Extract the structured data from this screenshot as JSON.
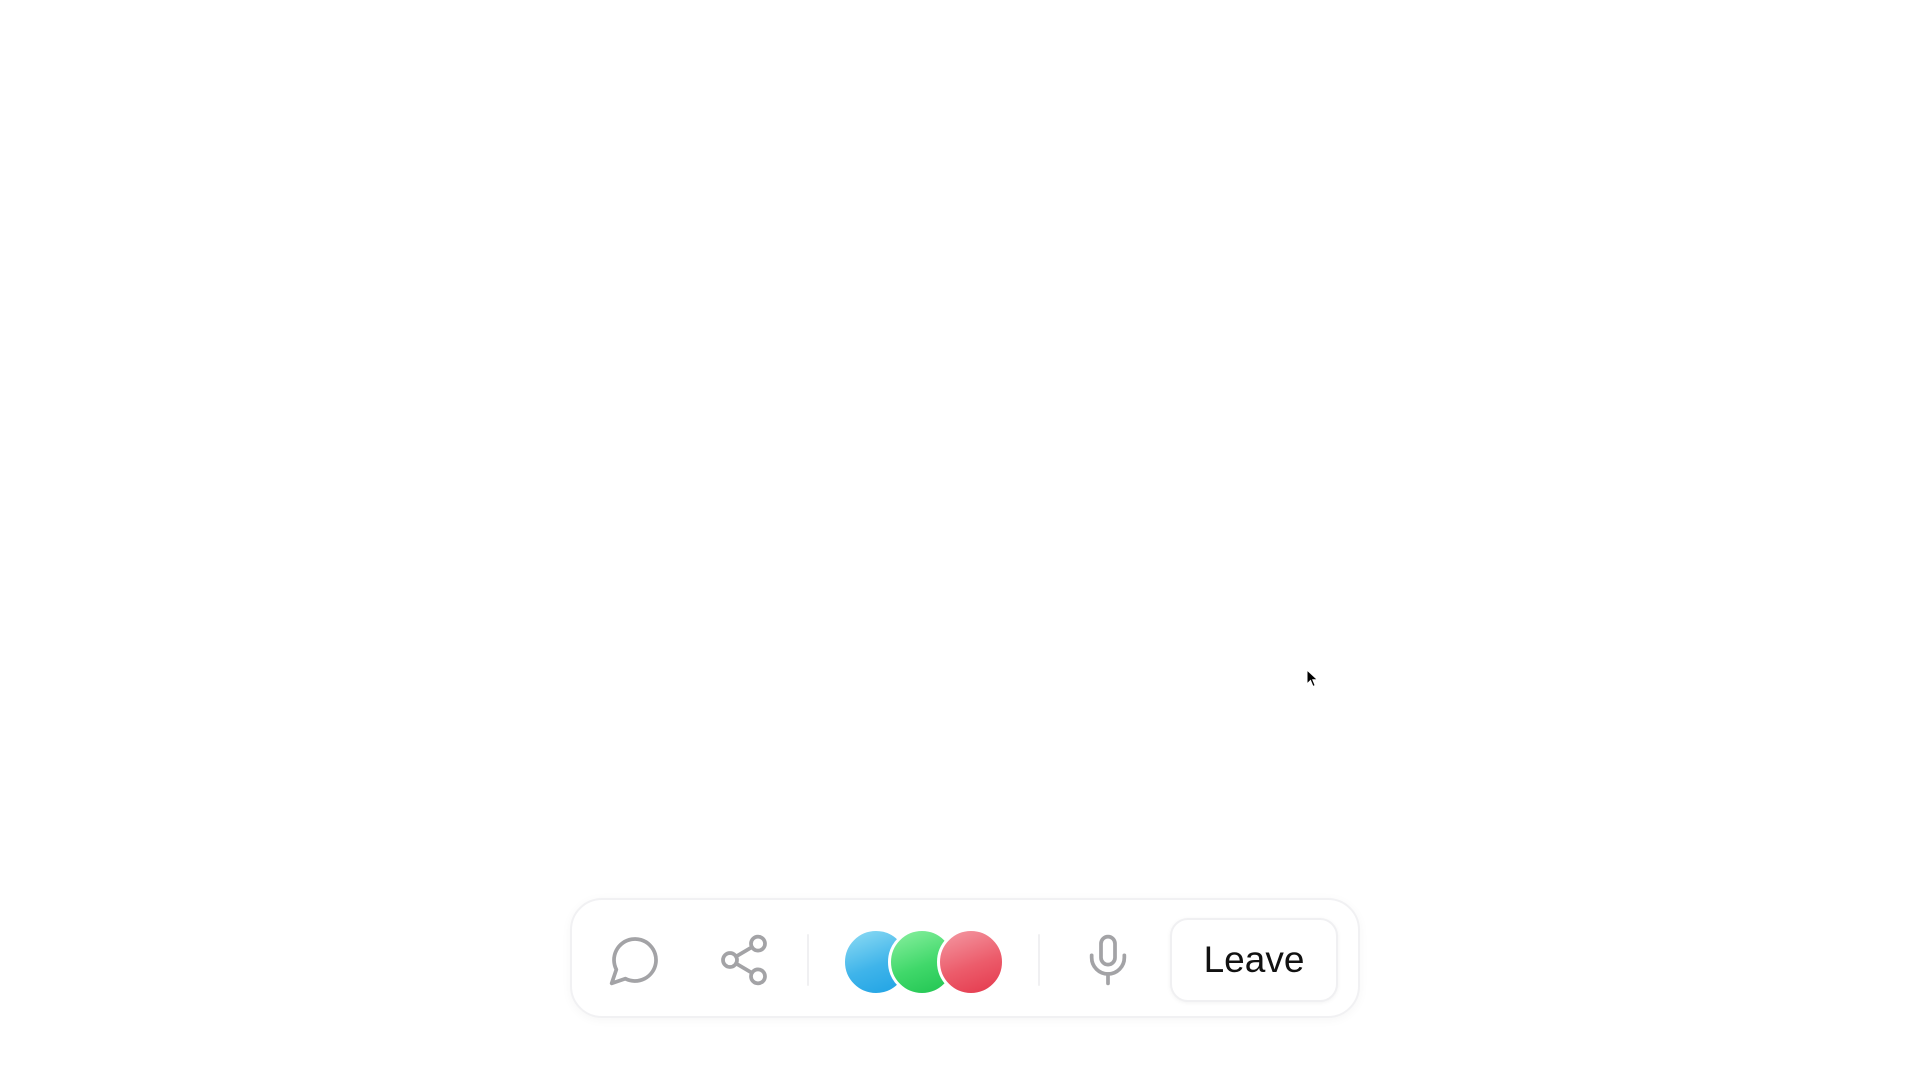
{
  "call_bar": {
    "chat_icon": "chat-bubble-icon",
    "share_icon": "share-icon",
    "participants": [
      {
        "avatar": "blue-gradient-avatar",
        "color": "#3fb4ea"
      },
      {
        "avatar": "green-gradient-avatar",
        "color": "#40d86a"
      },
      {
        "avatar": "red-gradient-avatar",
        "color": "#ec5c6b"
      }
    ],
    "mic_icon": "microphone-icon",
    "leave_label": "Leave"
  },
  "cursor": "arrow-cursor-icon"
}
